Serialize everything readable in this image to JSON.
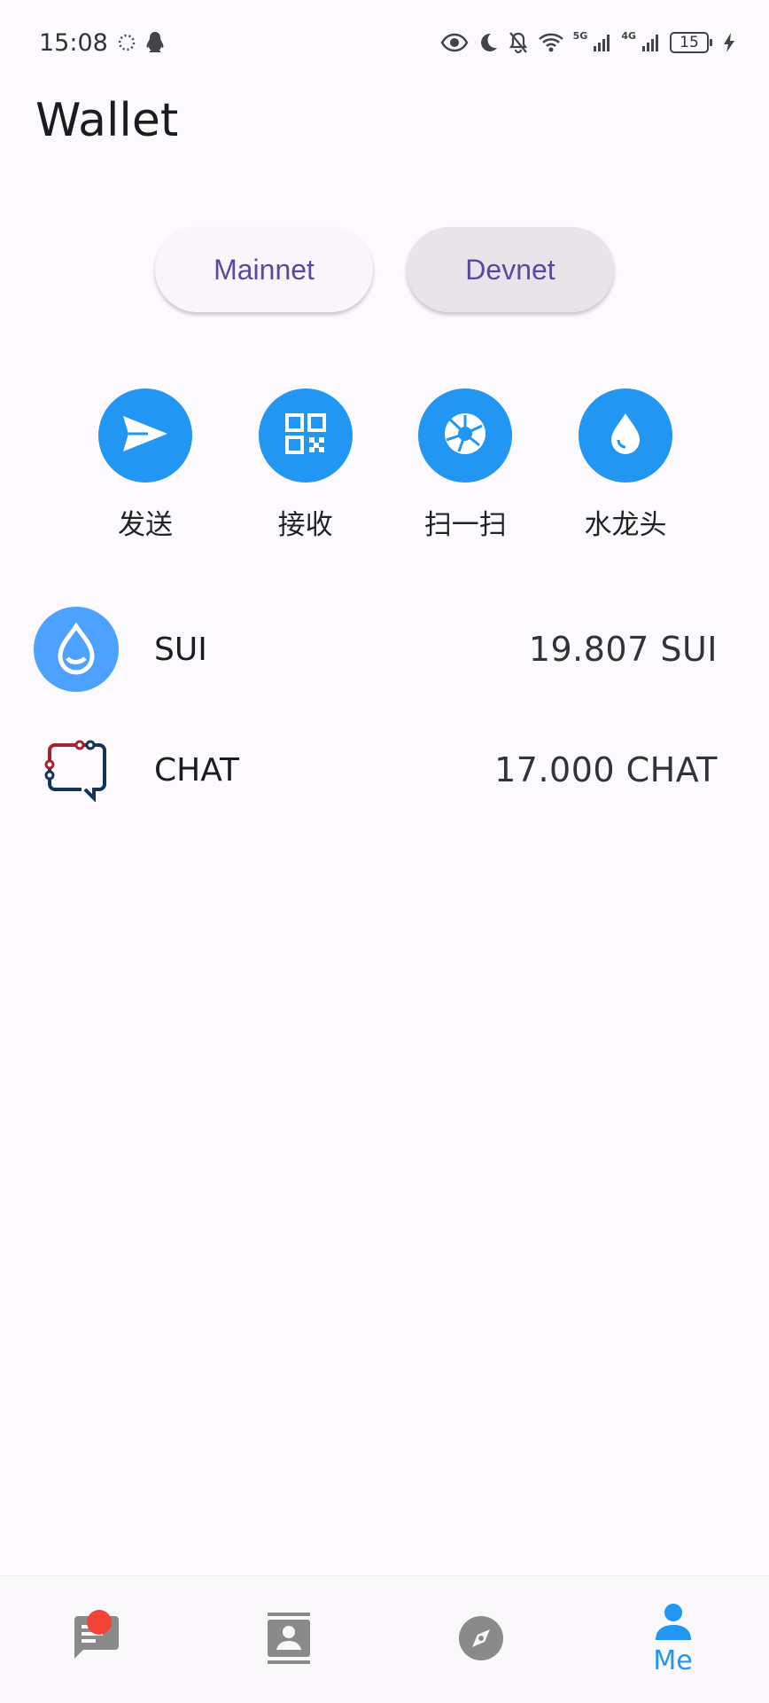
{
  "status_bar": {
    "time": "15:08",
    "battery_level": "15",
    "net_5g": "5G",
    "net_4g": "4G"
  },
  "header": {
    "title": "Wallet"
  },
  "networks": [
    {
      "label": "Mainnet",
      "selected": false
    },
    {
      "label": "Devnet",
      "selected": true
    }
  ],
  "actions": [
    {
      "label": "发送",
      "icon": "send-icon"
    },
    {
      "label": "接收",
      "icon": "qr-code-icon"
    },
    {
      "label": "扫一扫",
      "icon": "camera-shutter-icon"
    },
    {
      "label": "水龙头",
      "icon": "water-drop-icon"
    }
  ],
  "tokens": [
    {
      "name": "SUI",
      "balance": "19.807 SUI",
      "icon": "sui-logo-icon"
    },
    {
      "name": "CHAT",
      "balance": "17.000 CHAT",
      "icon": "chat-logo-icon"
    }
  ],
  "bottom_nav": {
    "items": [
      {
        "icon": "chat-list-icon",
        "label": "",
        "has_badge": true
      },
      {
        "icon": "contacts-icon",
        "label": ""
      },
      {
        "icon": "compass-icon",
        "label": ""
      },
      {
        "icon": "person-icon",
        "label": "Me",
        "active": true
      }
    ]
  },
  "colors": {
    "accent": "#2196f3",
    "network_text": "#5b4a9c",
    "background": "#fdfaff",
    "badge": "#f44336",
    "sui_brand": "#4da2ff"
  }
}
